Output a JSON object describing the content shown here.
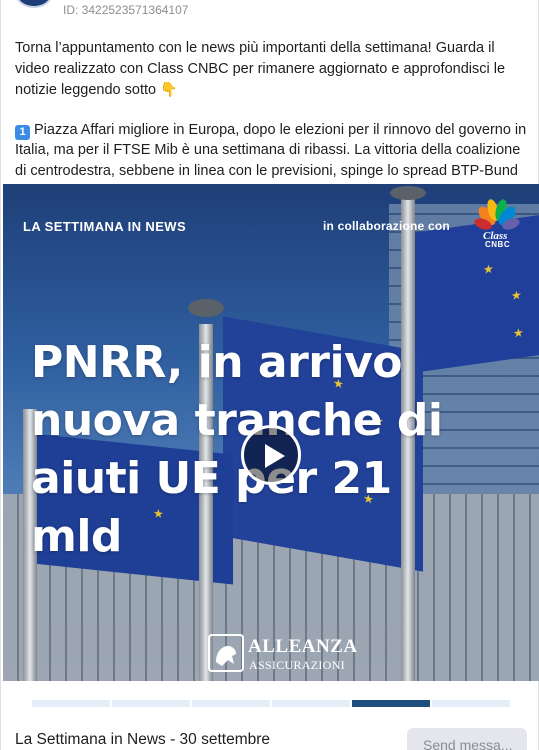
{
  "ad": {
    "id_label": "ID: 3422523571364107"
  },
  "post": {
    "paragraph1": "Torna l’appuntamento con le news più importanti della settimana! Guarda il video realizzato con Class CNBC per rimanere aggiornato e approfondisci le notizie leggendo sotto",
    "paragraph1_emoji": "👇",
    "item_number": "1",
    "paragraph2": "Piazza Affari migliore in Europa, dopo le elezioni per il rinnovo del governo in Italia, ma per il FTSE Mib è una settimana di ribassi. La vittoria della coalizione di centrodestra, sebbene in linea con le previsioni, spinge lo spread BTP-Bund oltre i…"
  },
  "media": {
    "top_label": "LA SETTIMANA IN NEWS",
    "collab_label": "in collaborazione con",
    "partner_logo_text": "Class",
    "partner_logo_sub": "CNBC",
    "headline": "PNRR, in arrivo nuova tranche di aiuti UE per 21 mld",
    "sponsor_name": "ALLEANZA",
    "sponsor_sub": "ASSICURAZIONI",
    "play_icon": "play-icon"
  },
  "carousel": {
    "segments": 6,
    "active_index": 4
  },
  "footer": {
    "title": "La Settimana in News - 30 settembre",
    "cta_label": "Send messa..."
  },
  "colors": {
    "accent": "#1c4e80",
    "badge": "#3b8ce6",
    "segment_inactive": "#e4eef8"
  }
}
